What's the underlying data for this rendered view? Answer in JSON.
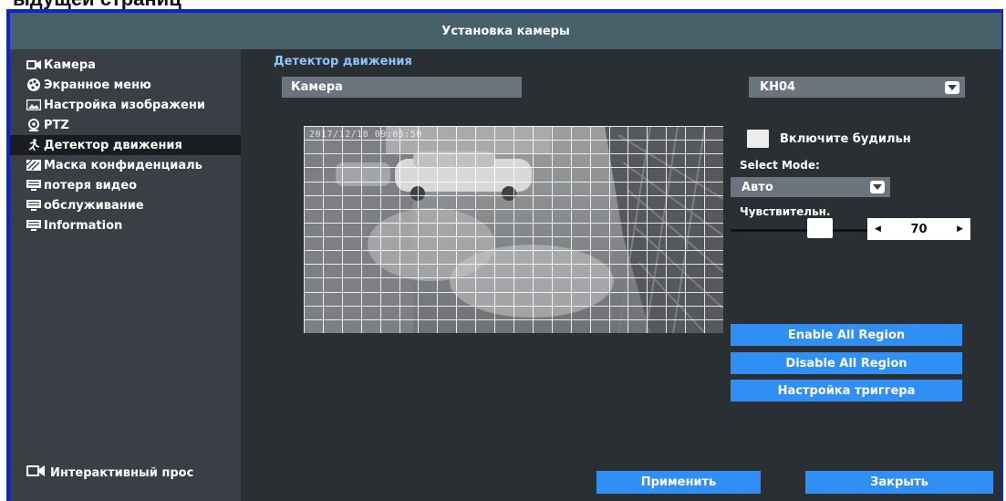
{
  "header": {
    "cropped_text": "ыдущей страниц"
  },
  "window": {
    "title": "Установка камеры"
  },
  "sidebar": {
    "items": [
      {
        "label": "Камера",
        "icon": "camera-icon",
        "active": false
      },
      {
        "label": "Экранное меню",
        "icon": "palette-icon",
        "active": false
      },
      {
        "label": "Настройка изображени",
        "icon": "image-icon",
        "active": false
      },
      {
        "label": "PTZ",
        "icon": "ptz-icon",
        "active": false
      },
      {
        "label": "Детектор движения",
        "icon": "motion-icon",
        "active": true
      },
      {
        "label": "Маска конфиденциаль",
        "icon": "privacy-mask-icon",
        "active": false
      },
      {
        "label": "потеря видео",
        "icon": "monitor-icon",
        "active": false
      },
      {
        "label": "обслуживание",
        "icon": "monitor-icon",
        "active": false
      },
      {
        "label": "Information",
        "icon": "monitor-icon",
        "active": false
      }
    ],
    "footer": {
      "label": "Интерактивный прос",
      "icon": "camera-icon"
    }
  },
  "main": {
    "section_title": "Детектор движения",
    "camera_label": "Камера",
    "camera_select": {
      "value": "KH04"
    },
    "video": {
      "timestamp": "2017/12/18 09:05:50",
      "grid_cols": 22,
      "grid_rows": 15
    },
    "alarm_checkbox": {
      "label": "Включите будильн",
      "checked": false
    },
    "mode": {
      "label": "Select Mode:",
      "value": "Авто"
    },
    "sensitivity": {
      "label": "Чувствительн.",
      "value": "70",
      "slider_level": 0.75
    },
    "buttons": {
      "enable_all": "Enable All Region",
      "disable_all": "Disable All Region",
      "trigger": "Настройка триггера"
    }
  },
  "footer": {
    "apply": "Применить",
    "close": "Закрыть"
  },
  "colors": {
    "titlebar": "#46616a",
    "sidebar": "#3a3f45",
    "background": "#2a2f34",
    "accent": "#2f8ff4",
    "active_item": "#1b1c20",
    "section_title": "#8fc4ff"
  }
}
